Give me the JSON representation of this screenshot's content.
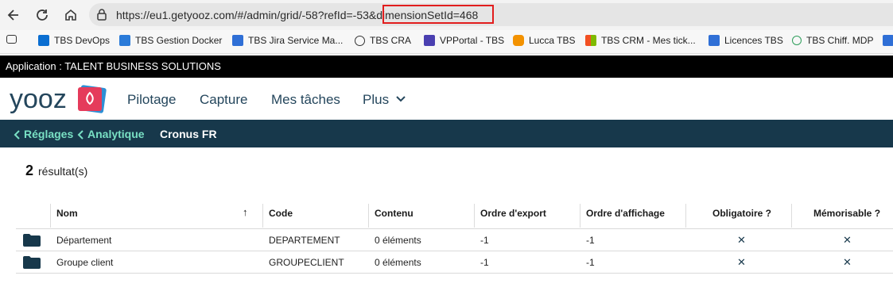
{
  "browser": {
    "url": "https://eu1.getyooz.com/#/admin/grid/-58?refId=-53&dimensionSetId=468",
    "bookmarks": [
      {
        "label": "",
        "icon": "reading-list-icon"
      },
      {
        "label": "TBS DevOps",
        "icon": "devops-icon"
      },
      {
        "label": "TBS Gestion Docker",
        "icon": "grid-icon"
      },
      {
        "label": "TBS Jira Service Ma...",
        "icon": "table-icon"
      },
      {
        "label": "TBS CRA",
        "icon": "globe-icon"
      },
      {
        "label": "VPPortal - TBS",
        "icon": "hand-icon"
      },
      {
        "label": "Lucca TBS",
        "icon": "lucca-icon"
      },
      {
        "label": "TBS CRM - Mes tick...",
        "icon": "windows-icon"
      },
      {
        "label": "Licences TBS",
        "icon": "table-icon"
      },
      {
        "label": "TBS Chiff. MDP",
        "icon": "share-icon"
      }
    ]
  },
  "app": {
    "banner": "Application : TALENT BUSINESS SOLUTIONS",
    "logo_text": "yooz",
    "menu": [
      "Pilotage",
      "Capture",
      "Mes tâches",
      "Plus"
    ],
    "breadcrumb": [
      "Réglages",
      "Analytique"
    ],
    "current_page": "Cronus FR"
  },
  "results": {
    "count": "2",
    "label": "résultat(s)"
  },
  "table": {
    "columns": [
      "Nom",
      "Code",
      "Contenu",
      "Ordre d'export",
      "Ordre d'affichage",
      "Obligatoire ?",
      "Mémorisable ?"
    ],
    "sort_indicator": "↑",
    "rows": [
      {
        "nom": "Département",
        "code": "DEPARTEMENT",
        "contenu": "0 éléments",
        "export": "-1",
        "affichage": "-1",
        "obligatoire": "✕",
        "memorisable": "✕"
      },
      {
        "nom": "Groupe client",
        "code": "GROUPECLIENT",
        "contenu": "0 éléments",
        "export": "-1",
        "affichage": "-1",
        "obligatoire": "✕",
        "memorisable": "✕"
      }
    ]
  },
  "colors": {
    "navy": "#17384b",
    "accent": "#79e0c4",
    "highlight": "#e11d1d"
  }
}
